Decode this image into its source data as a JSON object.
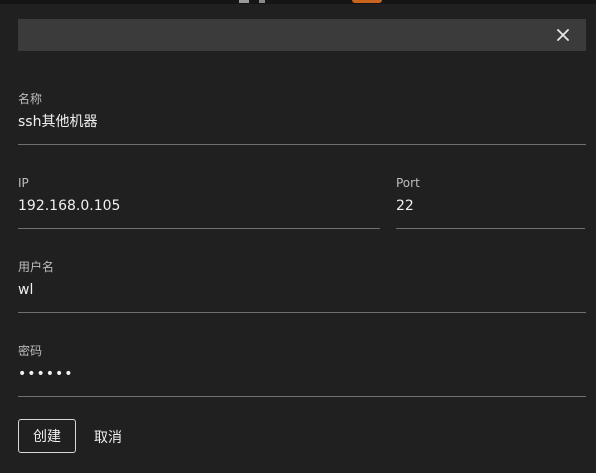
{
  "dialog": {
    "close_icon": "close-icon"
  },
  "form": {
    "name": {
      "label": "名称",
      "value": "ssh其他机器"
    },
    "ip": {
      "label": "IP",
      "value": "192.168.0.105"
    },
    "port": {
      "label": "Port",
      "value": "22"
    },
    "username": {
      "label": "用户名",
      "value": "wl"
    },
    "password": {
      "label": "密码",
      "value": "••••••"
    }
  },
  "actions": {
    "create_label": "创建",
    "cancel_label": "取消"
  },
  "colors": {
    "background": "#202020",
    "header_bar": "#3b3b3b",
    "underline": "#6e6e6e",
    "accent_top": "#c8641e"
  }
}
